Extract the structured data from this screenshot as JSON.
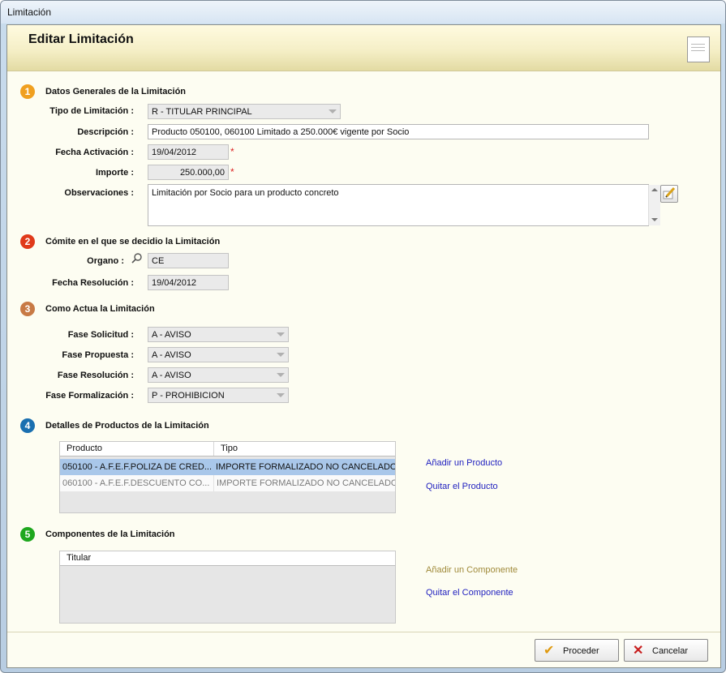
{
  "window": {
    "title": "Limitación"
  },
  "header": {
    "title": "Editar Limitación"
  },
  "section1": {
    "number": "1",
    "title": "Datos Generales de la Limitación",
    "tipo_label": "Tipo de Limitación :",
    "tipo_value": "R - TITULAR PRINCIPAL",
    "descripcion_label": "Descripción :",
    "descripcion_value": "Producto 050100, 060100 Limitado a 250.000€ vigente por Socio",
    "fecha_label": "Fecha Activación :",
    "fecha_value": "19/04/2012",
    "importe_label": "Importe :",
    "importe_value": "250.000,00",
    "observaciones_label": "Observaciones :",
    "observaciones_value": "Limitación por Socio para un producto concreto",
    "required_mark": "*"
  },
  "section2": {
    "number": "2",
    "title": "Cómite en el que se decidio la Limitación",
    "organo_label": "Organo :",
    "organo_value": "CE",
    "fecha_res_label": "Fecha Resolución :",
    "fecha_res_value": "19/04/2012"
  },
  "section3": {
    "number": "3",
    "title": "Como Actua la Limitación",
    "fases": [
      {
        "label": "Fase Solicitud :",
        "value": "A - AVISO"
      },
      {
        "label": "Fase Propuesta :",
        "value": "A - AVISO"
      },
      {
        "label": "Fase Resolución :",
        "value": "A - AVISO"
      },
      {
        "label": "Fase Formalización :",
        "value": "P - PROHIBICION"
      }
    ]
  },
  "section4": {
    "number": "4",
    "title": "Detalles de Productos de la Limitación",
    "columns": [
      "Producto",
      "Tipo"
    ],
    "rows": [
      {
        "producto": "050100 - A.F.E.F.POLIZA DE CRED...",
        "tipo": "IMPORTE FORMALIZADO NO CANCELADO"
      },
      {
        "producto": "060100 - A.F.E.F.DESCUENTO CO...",
        "tipo": "IMPORTE FORMALIZADO NO CANCELADO"
      }
    ],
    "add_link": "Añadir un Producto",
    "remove_link": "Quitar el Producto"
  },
  "section5": {
    "number": "5",
    "title": "Componentes de la Limitación",
    "columns": [
      "Titular"
    ],
    "add_link": "Añadir un Componente",
    "remove_link": "Quitar el Componente"
  },
  "footer": {
    "proceed_label": "Proceder",
    "cancel_label": "Cancelar"
  },
  "colors": {
    "badge1": "#f0a020",
    "badge2": "#e03a1a",
    "badge3": "#c87a45",
    "badge4": "#1a6fb0",
    "badge5": "#1ea71e",
    "selected_row": "#a9c7ea",
    "link": "#1f1fbf"
  },
  "icons": {
    "organo_search": "magnifier-icon",
    "observaciones_edit": "pencil-notepad-icon",
    "proceed": "checkmark-icon",
    "cancel": "x-icon",
    "header_doc": "document-icon"
  }
}
